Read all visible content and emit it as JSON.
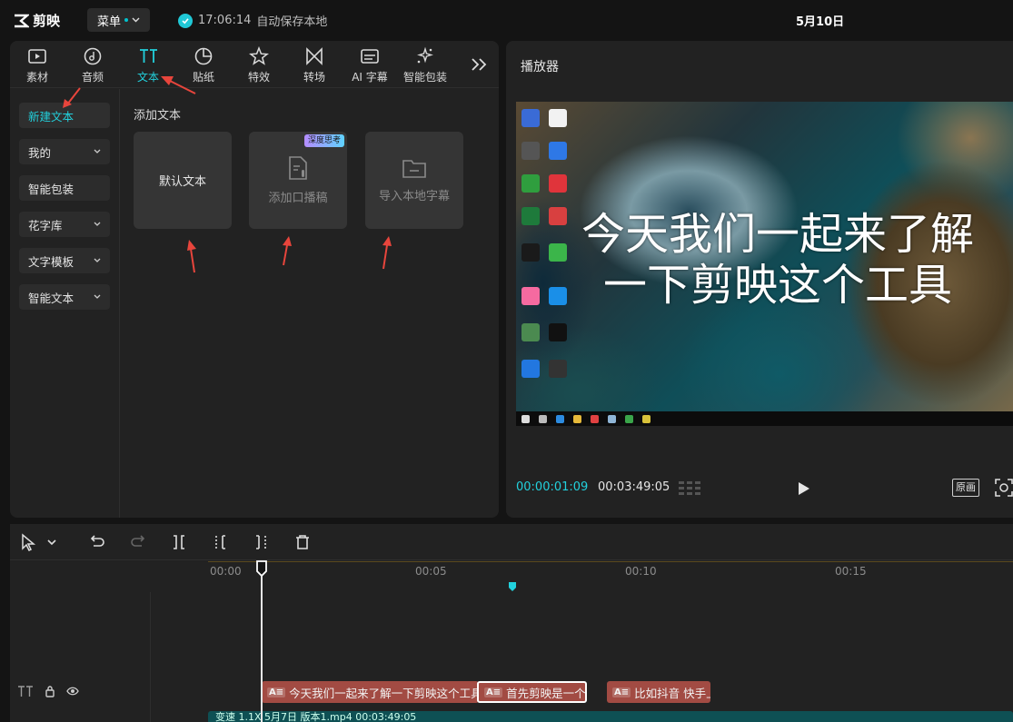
{
  "app": {
    "name": "剪映",
    "menu_label": "菜单"
  },
  "autosave": {
    "time": "17:06:14",
    "text": "自动保存本地"
  },
  "project_title": "5月10日",
  "tabs": [
    {
      "label": "素材",
      "icon": "media-icon"
    },
    {
      "label": "音频",
      "icon": "audio-icon"
    },
    {
      "label": "文本",
      "icon": "text-icon",
      "active": true
    },
    {
      "label": "贴纸",
      "icon": "sticker-icon"
    },
    {
      "label": "特效",
      "icon": "effects-icon"
    },
    {
      "label": "转场",
      "icon": "transition-icon"
    },
    {
      "label": "AI 字幕",
      "icon": "ai-caption-icon"
    },
    {
      "label": "智能包装",
      "icon": "smart-package-icon"
    }
  ],
  "side_nav": [
    {
      "label": "新建文本",
      "active": true,
      "dropdown": false
    },
    {
      "label": "我的",
      "dropdown": true
    },
    {
      "label": "智能包装",
      "dropdown": false
    },
    {
      "label": "花字库",
      "dropdown": true
    },
    {
      "label": "文字模板",
      "dropdown": true
    },
    {
      "label": "智能文本",
      "dropdown": true
    }
  ],
  "add_text": {
    "section_title": "添加文本",
    "cards": [
      {
        "label": "默认文本"
      },
      {
        "label": "添加口播稿",
        "badge": "深度思考"
      },
      {
        "label": "导入本地字幕"
      }
    ]
  },
  "player": {
    "title": "播放器",
    "subtitle_line1": "今天我们一起来了解",
    "subtitle_line2": "一下剪映这个工具",
    "current_time": "00:00:01:09",
    "total_time": "00:03:49:05",
    "original_ratio_label": "原画"
  },
  "timeline": {
    "ruler": [
      "00:00",
      "00:05",
      "00:10",
      "00:15"
    ],
    "clips": [
      {
        "text": "今天我们一起来了解一下剪映这个工具"
      },
      {
        "text": "首先剪映是一个",
        "selected": true
      },
      {
        "text": "比如抖音 快手上"
      }
    ],
    "video_clip_text": "变速 1.1X  5月7日 版本1.mp4  00:03:49:05"
  },
  "colors": {
    "accent": "#22d1dd",
    "clip": "#a24b43",
    "annotation_arrow": "#e8453c"
  }
}
